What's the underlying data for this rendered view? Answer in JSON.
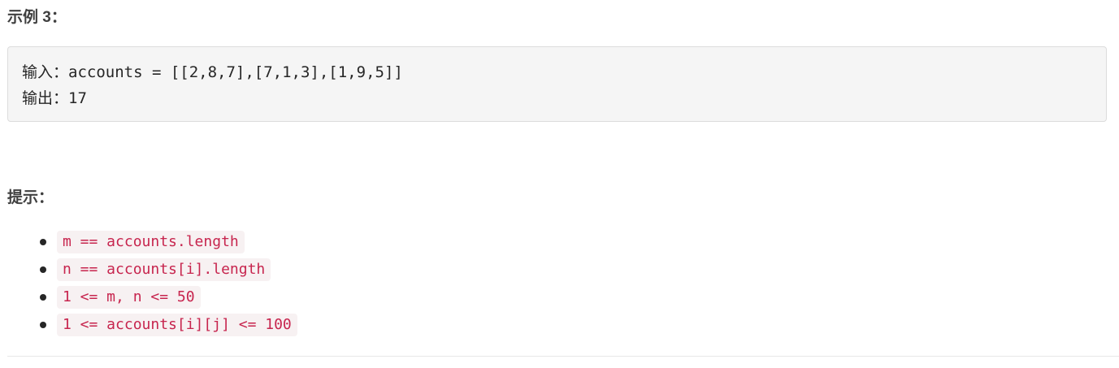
{
  "example": {
    "heading": "示例 3：",
    "input_label": "输入：",
    "input_value": "accounts = [[2,8,7],[7,1,3],[1,9,5]]",
    "output_label": "输出：",
    "output_value": "17"
  },
  "constraints": {
    "heading": "提示：",
    "items": [
      "m == accounts.length",
      "n == accounts[i].length",
      "1 <= m, n <= 50",
      "1 <= accounts[i][j] <= 100"
    ]
  }
}
